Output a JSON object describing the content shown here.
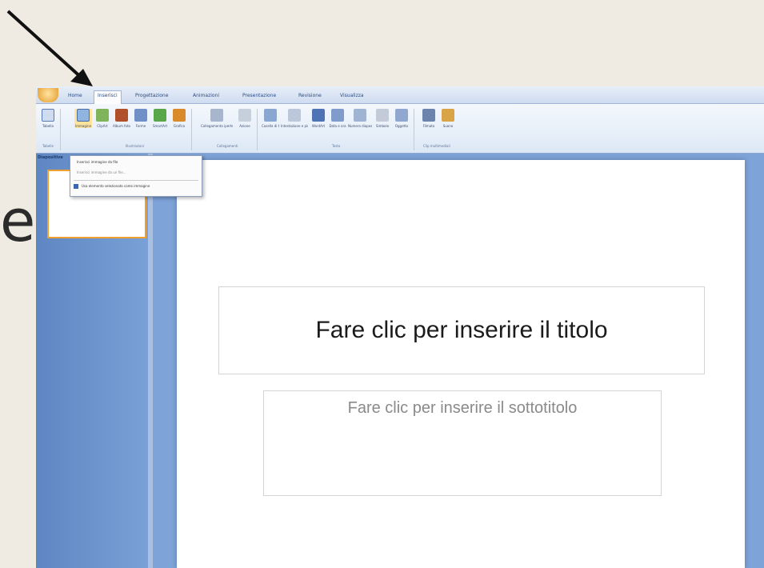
{
  "background": {
    "partial_letter": "e"
  },
  "ribbon": {
    "tabs": [
      "Home",
      "Inserisci",
      "Progettazione",
      "Animazioni",
      "Presentazione",
      "Revisione",
      "Visualizza"
    ],
    "active_tab": "Inserisci",
    "groups": [
      {
        "label": "Tabelle",
        "buttons": [
          {
            "label": "Tabella",
            "icon": "table-icon"
          }
        ]
      },
      {
        "label": "Illustrazioni",
        "buttons": [
          {
            "label": "Immagine",
            "icon": "picture-icon"
          },
          {
            "label": "ClipArt",
            "icon": "clipart-icon"
          },
          {
            "label": "Album foto",
            "icon": "photo-album-icon"
          },
          {
            "label": "Forme",
            "icon": "shapes-icon"
          },
          {
            "label": "SmartArt",
            "icon": "smartart-icon"
          },
          {
            "label": "Grafico",
            "icon": "chart-icon"
          }
        ]
      },
      {
        "label": "Collegamenti",
        "buttons": [
          {
            "label": "Collegamento ipertestuale",
            "icon": "hyperlink-icon"
          },
          {
            "label": "Azione",
            "icon": "action-icon"
          }
        ]
      },
      {
        "label": "Testo",
        "buttons": [
          {
            "label": "Casella di testo",
            "icon": "textbox-icon"
          },
          {
            "label": "Intestazione e piè di pagina",
            "icon": "header-footer-icon"
          },
          {
            "label": "WordArt",
            "icon": "wordart-icon"
          },
          {
            "label": "Data e ora",
            "icon": "date-time-icon"
          },
          {
            "label": "Numero diapositiva",
            "icon": "slide-number-icon"
          },
          {
            "label": "Simbolo",
            "icon": "symbol-icon"
          },
          {
            "label": "Oggetto",
            "icon": "object-icon"
          }
        ]
      },
      {
        "label": "Clip multimediali",
        "buttons": [
          {
            "label": "Filmato",
            "icon": "movie-icon"
          },
          {
            "label": "Suono",
            "icon": "sound-icon"
          }
        ]
      }
    ]
  },
  "pane": {
    "tab_label": "Diapositive"
  },
  "dropdown": {
    "items": [
      "Inserisci immagine da file",
      "Inserisci immagine da un file...",
      "Usa elemento selezionato come immagine"
    ]
  },
  "slide": {
    "title_placeholder": "Fare clic per inserire il titolo",
    "subtitle_placeholder": "Fare clic per inserire il sottotitolo"
  },
  "colors": {
    "ribbon_accent": "#2a4c86",
    "window_blue": "#6f93c9",
    "thumbnail_border": "#f0a030"
  }
}
